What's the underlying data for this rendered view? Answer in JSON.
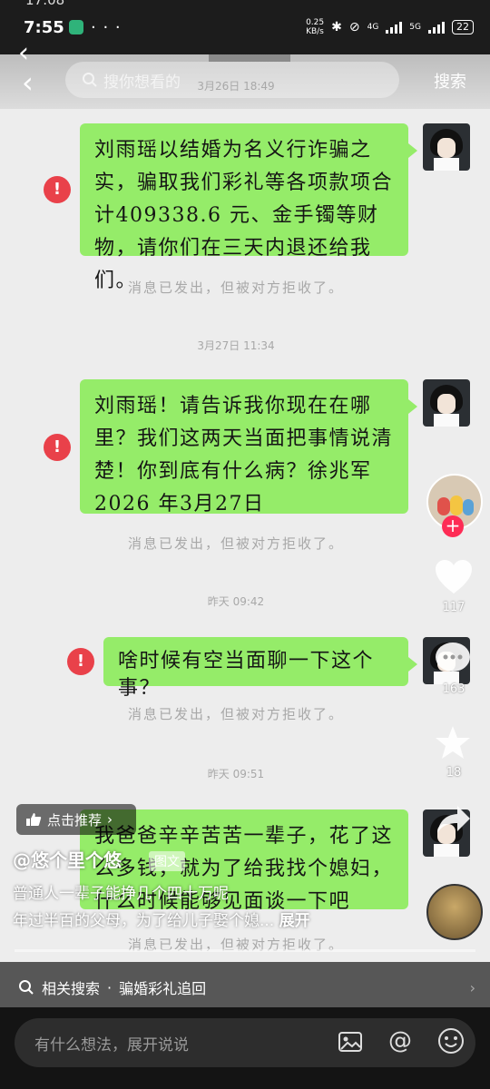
{
  "status_bar": {
    "stale_time": "17:08",
    "time": "7:55",
    "speed": "0.25\nKB/s",
    "network": "4G",
    "network2": "5G",
    "battery": "22"
  },
  "search": {
    "placeholder": "搜你想看的",
    "button": "搜索"
  },
  "chat": {
    "timestamps": [
      "3月26日 18:49",
      "3月27日 11:34",
      "昨天 09:42",
      "昨天 09:51"
    ],
    "messages": [
      {
        "text": "刘雨瑶以结婚为名义行诈骗之实，骗取我们彩礼等各项款项合计409338.6 元、金手镯等财物，请你们在三天内退还给我们。"
      },
      {
        "text": "刘雨瑶！请告诉我你现在在哪里？我们这两天当面把事情说清楚！你到底有什么病？徐兆军　2026 年3月27日"
      },
      {
        "text": "啥时候有空当面聊一下这个事？"
      },
      {
        "text": "我爸爸辛辛苦苦一辈子，花了这么多钱，就为了给我找个媳妇，什么时候能够见面谈一下吧"
      }
    ],
    "rejected_notice": "消息已发出，但被对方拒收了。",
    "error_mark": "!"
  },
  "rail": {
    "likes": "117",
    "comments": "163",
    "favorites": "18",
    "shares": ""
  },
  "video": {
    "promo": "点击推荐",
    "author": "@悠个里个悠",
    "tag": "图文",
    "caption_line1": "普通人一辈子能挣几个四十万呢",
    "caption_line2": "年过半百的父母，为了给儿子娶个媳...",
    "expand": "展开"
  },
  "related_search": {
    "label": "相关搜索",
    "dot": "·",
    "query": "骗婚彩礼追回"
  },
  "comment_bar": {
    "placeholder": "有什么想法，展开说说"
  }
}
